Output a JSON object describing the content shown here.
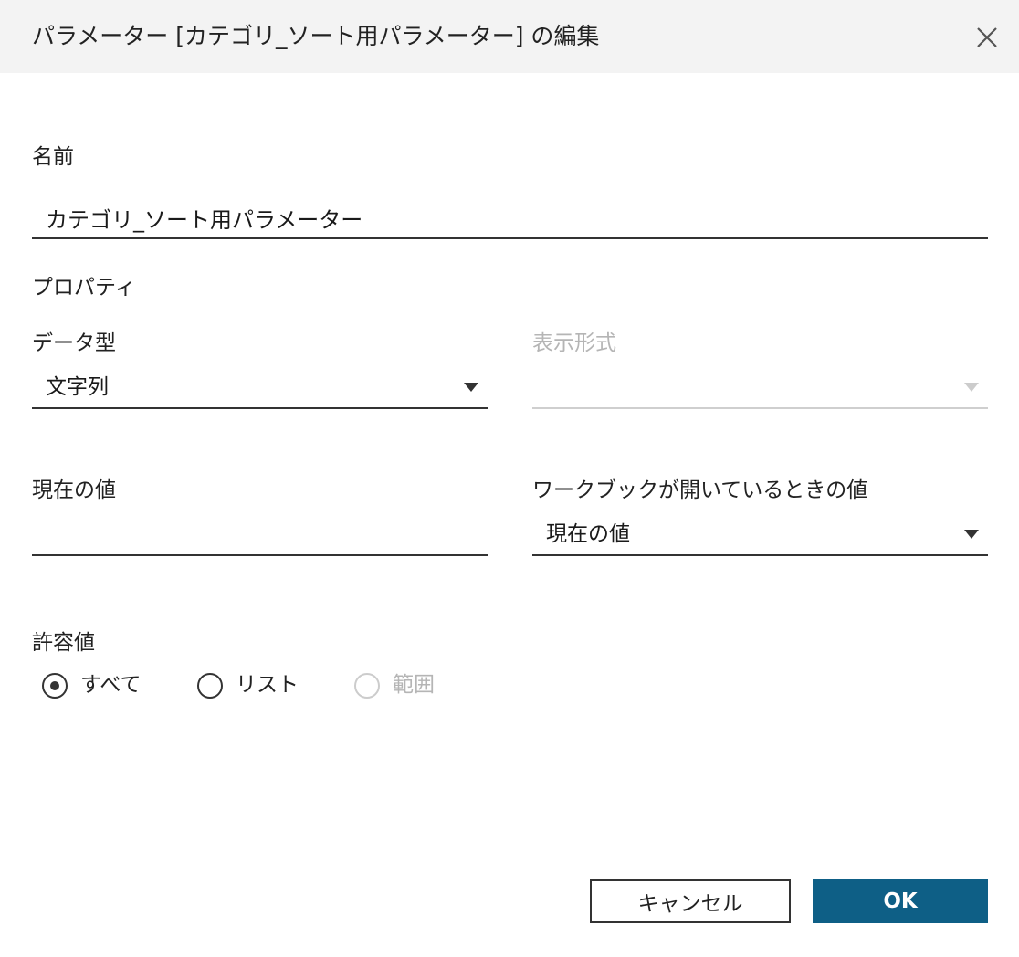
{
  "dialog": {
    "title": "パラメーター [カテゴリ_ソート用パラメーター] の編集"
  },
  "name_section": {
    "label": "名前",
    "value": "カテゴリ_ソート用パラメーター"
  },
  "properties": {
    "heading": "プロパティ",
    "data_type": {
      "label": "データ型",
      "selected": "文字列"
    },
    "display_format": {
      "label": "表示形式",
      "selected": "",
      "disabled": true
    },
    "current_value": {
      "label": "現在の値",
      "value": ""
    },
    "workbook_open_value": {
      "label": "ワークブックが開いているときの値",
      "selected": "現在の値"
    }
  },
  "allowable_values": {
    "label": "許容値",
    "options": [
      {
        "label": "すべて",
        "checked": true,
        "disabled": false
      },
      {
        "label": "リスト",
        "checked": false,
        "disabled": false
      },
      {
        "label": "範囲",
        "checked": false,
        "disabled": true
      }
    ]
  },
  "footer": {
    "cancel_label": "キャンセル",
    "ok_label": "OK"
  },
  "colors": {
    "ok_button": "#0e5f86",
    "titlebar_bg": "#f3f3f3",
    "disabled_text": "#b5b5b5"
  },
  "icons": {
    "close": "close-icon",
    "dropdown": "caret-down-icon"
  }
}
